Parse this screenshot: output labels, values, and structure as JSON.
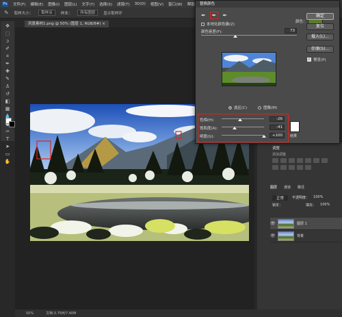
{
  "menubar": {
    "logo": "Ps",
    "items": [
      "文件(F)",
      "编辑(E)",
      "图像(I)",
      "图层(L)",
      "文字(Y)",
      "选择(S)",
      "滤镜(T)",
      "3D(D)",
      "视图(V)",
      "窗口(W)",
      "帮助(H)"
    ]
  },
  "options": {
    "sample_size_label": "取样大小：",
    "sample_size_value": "取样点",
    "sample_all_label": "样本：",
    "sample_all_value": "所有图层",
    "show_ring": "显示取样环"
  },
  "document": {
    "tab_title": "风景素材1.png @ 50% (图层 1, RGB/8#) ×"
  },
  "status": {
    "zoom": "50%",
    "doc_size": "文档:3.75M/7.40M"
  },
  "dialog": {
    "title": "替换颜色",
    "localized_clusters": "本地化颜色簇(Z)",
    "color_label": "颜色：",
    "color_swatch": "#5a7a2e",
    "fuzziness_label": "颜色容差(F):",
    "fuzziness_value": "73",
    "fuzziness_fraction": 0.36,
    "selection_label": "选区(C)",
    "image_label": "图像(M)",
    "replacement": {
      "hue_label": "色相(H):",
      "hue_value": "-26",
      "hue_fraction": 0.44,
      "saturation_label": "饱和度(A):",
      "saturation_value": "-41",
      "saturation_fraction": 0.3,
      "lightness_label": "明度(G):",
      "lightness_value": "+100",
      "lightness_fraction": 1.0,
      "result_label": "结果",
      "result_swatch": "#ffffff"
    },
    "buttons": {
      "ok": "确定",
      "reset": "复位",
      "load": "载入(L)...",
      "save": "存储(S)...",
      "preview": "预览(P)"
    },
    "highlight_color": "#e0231a"
  },
  "panels": {
    "adjustments_title": "调整",
    "add_adjustment": "添加调整",
    "layer_tabs": [
      "图层",
      "通道",
      "路径"
    ],
    "layers": [
      {
        "name": "图层 1",
        "active": true
      },
      {
        "name": "背景",
        "active": false
      }
    ],
    "blend_mode": "正常",
    "opacity_label": "不透明度：",
    "opacity_value": "100%",
    "fill_label": "填充：",
    "fill_value": "100%",
    "lock_label": "锁定："
  }
}
